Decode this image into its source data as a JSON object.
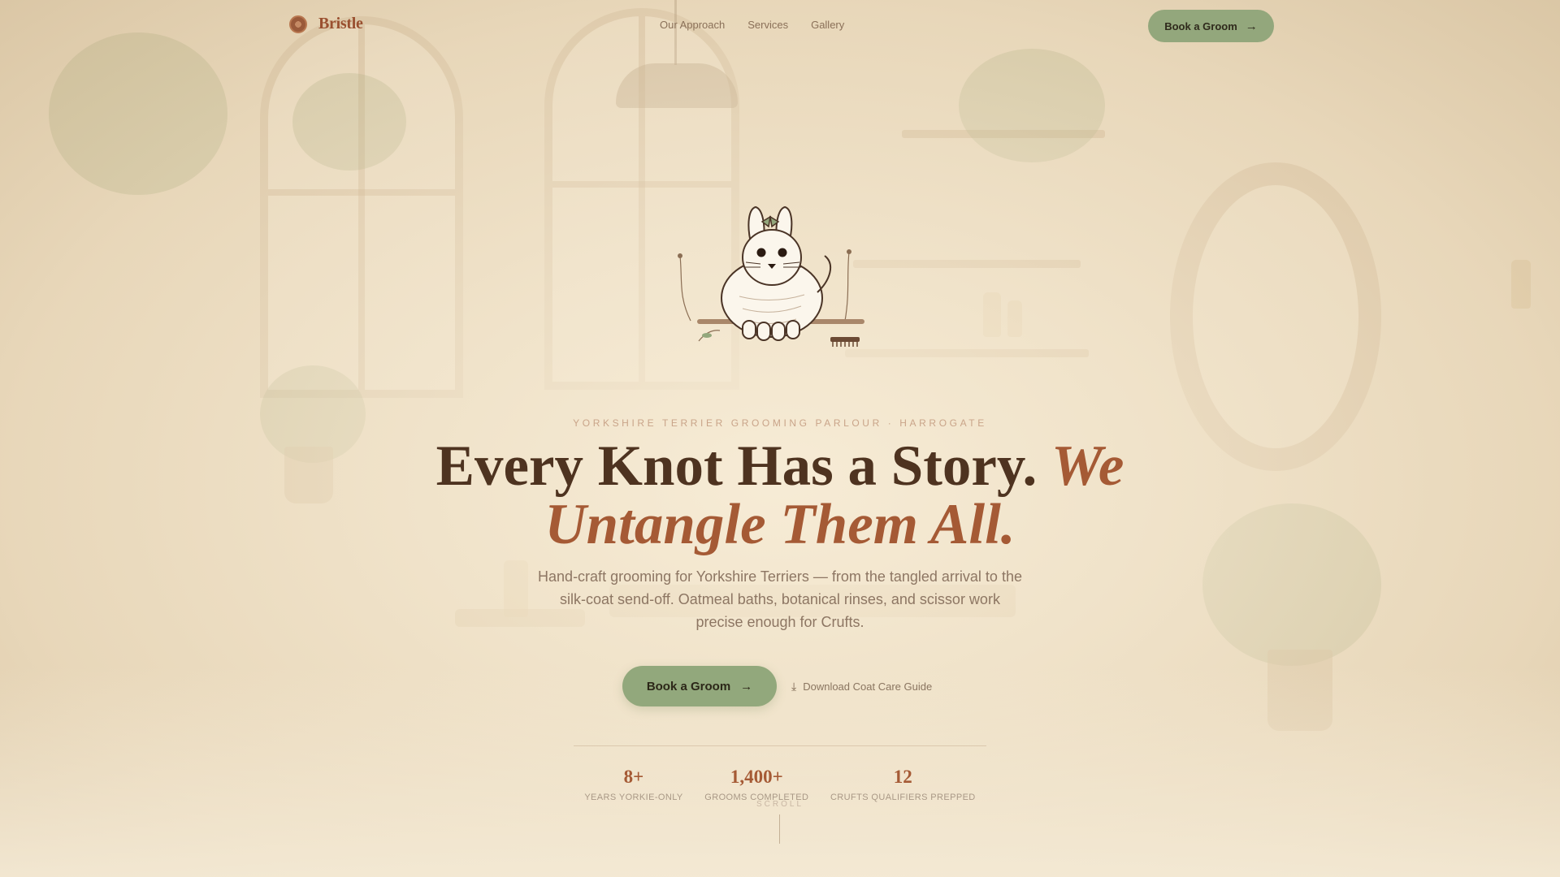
{
  "nav": {
    "brand": "Bristle",
    "links": [
      "Our Approach",
      "Services",
      "Gallery"
    ],
    "cta_label": "Book a Groom"
  },
  "hero": {
    "eyebrow": "YORKSHIRE TERRIER GROOMING PARLOUR · HARROGATE",
    "headline_main": "Every Knot Has a Story. ",
    "headline_accent": "We Untangle Them All.",
    "lede": "Hand-craft grooming for Yorkshire Terriers — from the tangled arrival to the silk-coat send-off. Oatmeal baths, botanical rinses, and scissor work precise enough for Crufts.",
    "primary_cta": "Book a Groom",
    "secondary_cta": "Download Coat Care Guide"
  },
  "stats": [
    {
      "value": "8+",
      "label": "YEARS YORKIE-ONLY"
    },
    {
      "value": "1,400+",
      "label": "GROOMS COMPLETED"
    },
    {
      "value": "12",
      "label": "CRUFTS QUALIFIERS PREPPED"
    }
  ],
  "scroll_label": "SCROLL",
  "colors": {
    "accent": "#a55a35",
    "button": "#92a87c",
    "heading": "#4e3320",
    "background": "#efe3cc"
  },
  "icons": {
    "brand": "bristle-logo-icon",
    "arrow": "arrow-right-icon",
    "download": "download-icon"
  }
}
